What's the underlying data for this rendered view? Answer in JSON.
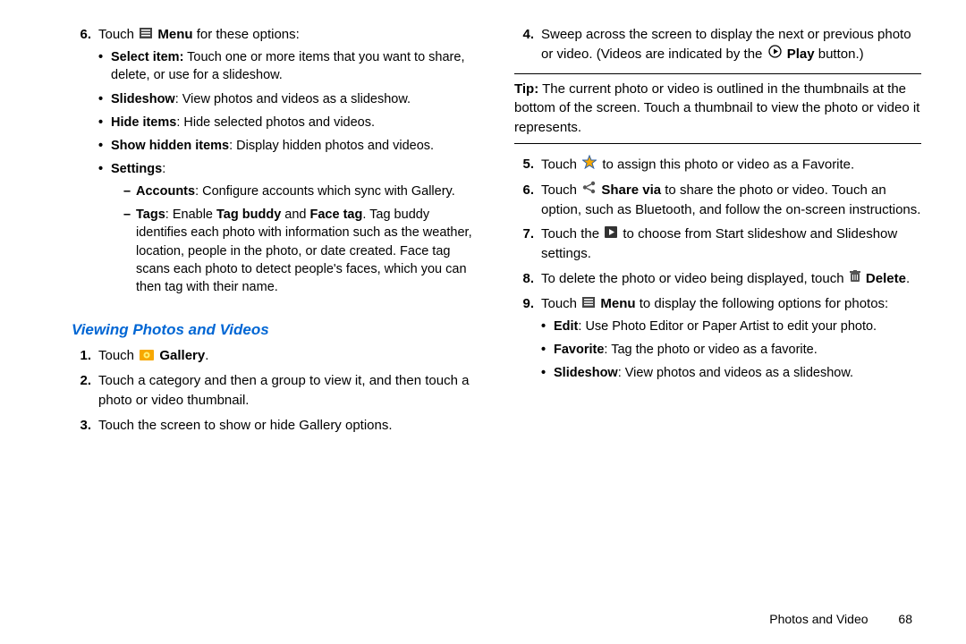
{
  "left": {
    "step6": {
      "num": "6.",
      "intro_pre": "Touch ",
      "intro_menu": "Menu",
      "intro_post": " for these options:",
      "b_select_label": "Select item:",
      "b_select_text": " Touch one or more items that you want to share, delete, or use for a slideshow.",
      "b_slideshow_label": "Slideshow",
      "b_slideshow_text": ": View photos and videos as a slideshow.",
      "b_hide_label": "Hide items",
      "b_hide_text": ": Hide selected photos and videos.",
      "b_showhidden_label": "Show hidden items",
      "b_showhidden_text": ": Display hidden photos and videos.",
      "b_settings_label": "Settings",
      "b_settings_colon": ":",
      "d_accounts_label": "Accounts",
      "d_accounts_text": ": Configure accounts which sync with Gallery.",
      "d_tags_label": "Tags",
      "d_tags_text1": ": Enable ",
      "d_tags_tagbuddy": "Tag buddy",
      "d_tags_and": " and ",
      "d_tags_facetag": "Face tag",
      "d_tags_text2": ". Tag buddy identifies each photo with information such as the weather, location, people in the photo, or date created. Face tag scans each photo to detect people's faces, which you can then tag with their name."
    },
    "heading": "Viewing Photos and Videos",
    "vstep1": {
      "num": "1.",
      "pre": "Touch ",
      "gallery": "Gallery",
      "post": "."
    },
    "vstep2": {
      "num": "2.",
      "text": "Touch a category and then a group to view it, and then touch a photo or video thumbnail."
    },
    "vstep3": {
      "num": "3.",
      "text": "Touch the screen to show or hide Gallery options."
    }
  },
  "right": {
    "step4": {
      "num": "4.",
      "text1": "Sweep across the screen to display the next or previous photo or video. (Videos are indicated by the ",
      "play": "Play",
      "text2": " button.)"
    },
    "tip_label": "Tip:",
    "tip_text": " The current photo or video is outlined in the thumbnails at the bottom of the screen. Touch a thumbnail to view the photo or video it represents.",
    "step5": {
      "num": "5.",
      "pre": "Touch ",
      "post": " to assign this photo or video as a Favorite."
    },
    "step6": {
      "num": "6.",
      "pre": "Touch ",
      "sharevia": "Share via",
      "post": " to share the photo or video. Touch an option, such as Bluetooth, and follow the on-screen instructions."
    },
    "step7": {
      "num": "7.",
      "pre": "Touch the ",
      "post": " to choose from Start slideshow and Slideshow settings."
    },
    "step8": {
      "num": "8.",
      "text1": "To delete the photo or video being displayed, touch ",
      "delete": "Delete",
      "text2": "."
    },
    "step9": {
      "num": "9.",
      "pre": "Touch ",
      "menu": "Menu",
      "post": " to display the following options for photos:",
      "b_edit_label": "Edit",
      "b_edit_text": ": Use Photo Editor or Paper Artist to edit your photo.",
      "b_fav_label": "Favorite",
      "b_fav_text": ": Tag the photo or video as a favorite.",
      "b_slide_label": "Slideshow",
      "b_slide_text": ": View photos and videos as a slideshow."
    }
  },
  "footer": {
    "section": "Photos and Video",
    "page": "68"
  }
}
